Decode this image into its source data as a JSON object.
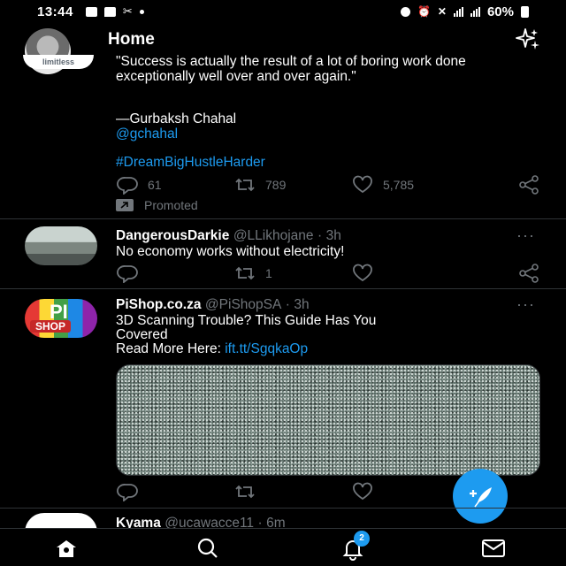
{
  "status_bar": {
    "time": "13:44",
    "battery": "60%",
    "icons": [
      "gallery-icon",
      "message-icon",
      "missed-call-icon",
      "dot-icon",
      "data-saver-icon",
      "alarm-icon",
      "mute-icon",
      "signal-icon",
      "signal-icon",
      "battery-icon"
    ]
  },
  "header": {
    "title": "Home",
    "sparkle_icon": "sparkle-icon"
  },
  "tweets": [
    {
      "avatar_label": "limitless",
      "text": "\"Success is actually the result of a lot of boring work done exceptionally well over and over again.\"",
      "author_line": "—Gurbaksh Chahal",
      "mention": "@gchahal",
      "hashtag": "#DreamBigHustleHarder",
      "replies": "61",
      "retweets": "789",
      "likes": "5,785",
      "promoted_label": "Promoted"
    },
    {
      "name": "DangerousDarkie",
      "handle": "@LLikhojane",
      "time": "3h",
      "text": "No economy works without electricity!",
      "replies": "",
      "retweets": "1",
      "likes": ""
    },
    {
      "name": "PiShop.co.za",
      "handle": "@PiShopSA",
      "time": "3h",
      "text_line1": "3D Scanning Trouble? This Guide Has You",
      "text_line2": "Covered",
      "text_line3_prefix": "Read More Here: ",
      "link": "ift.tt/SgqkaOp",
      "avatar_text": "PI",
      "avatar_sub": "SHOP"
    },
    {
      "name": "Kyama",
      "handle": "@ucawacce11",
      "time": "6m"
    }
  ],
  "dot_sep": "·",
  "more": "···",
  "nav": {
    "notifications_badge": "2"
  },
  "colors": {
    "accent": "#1d9bf0",
    "background": "#000000",
    "muted": "#71767b"
  }
}
